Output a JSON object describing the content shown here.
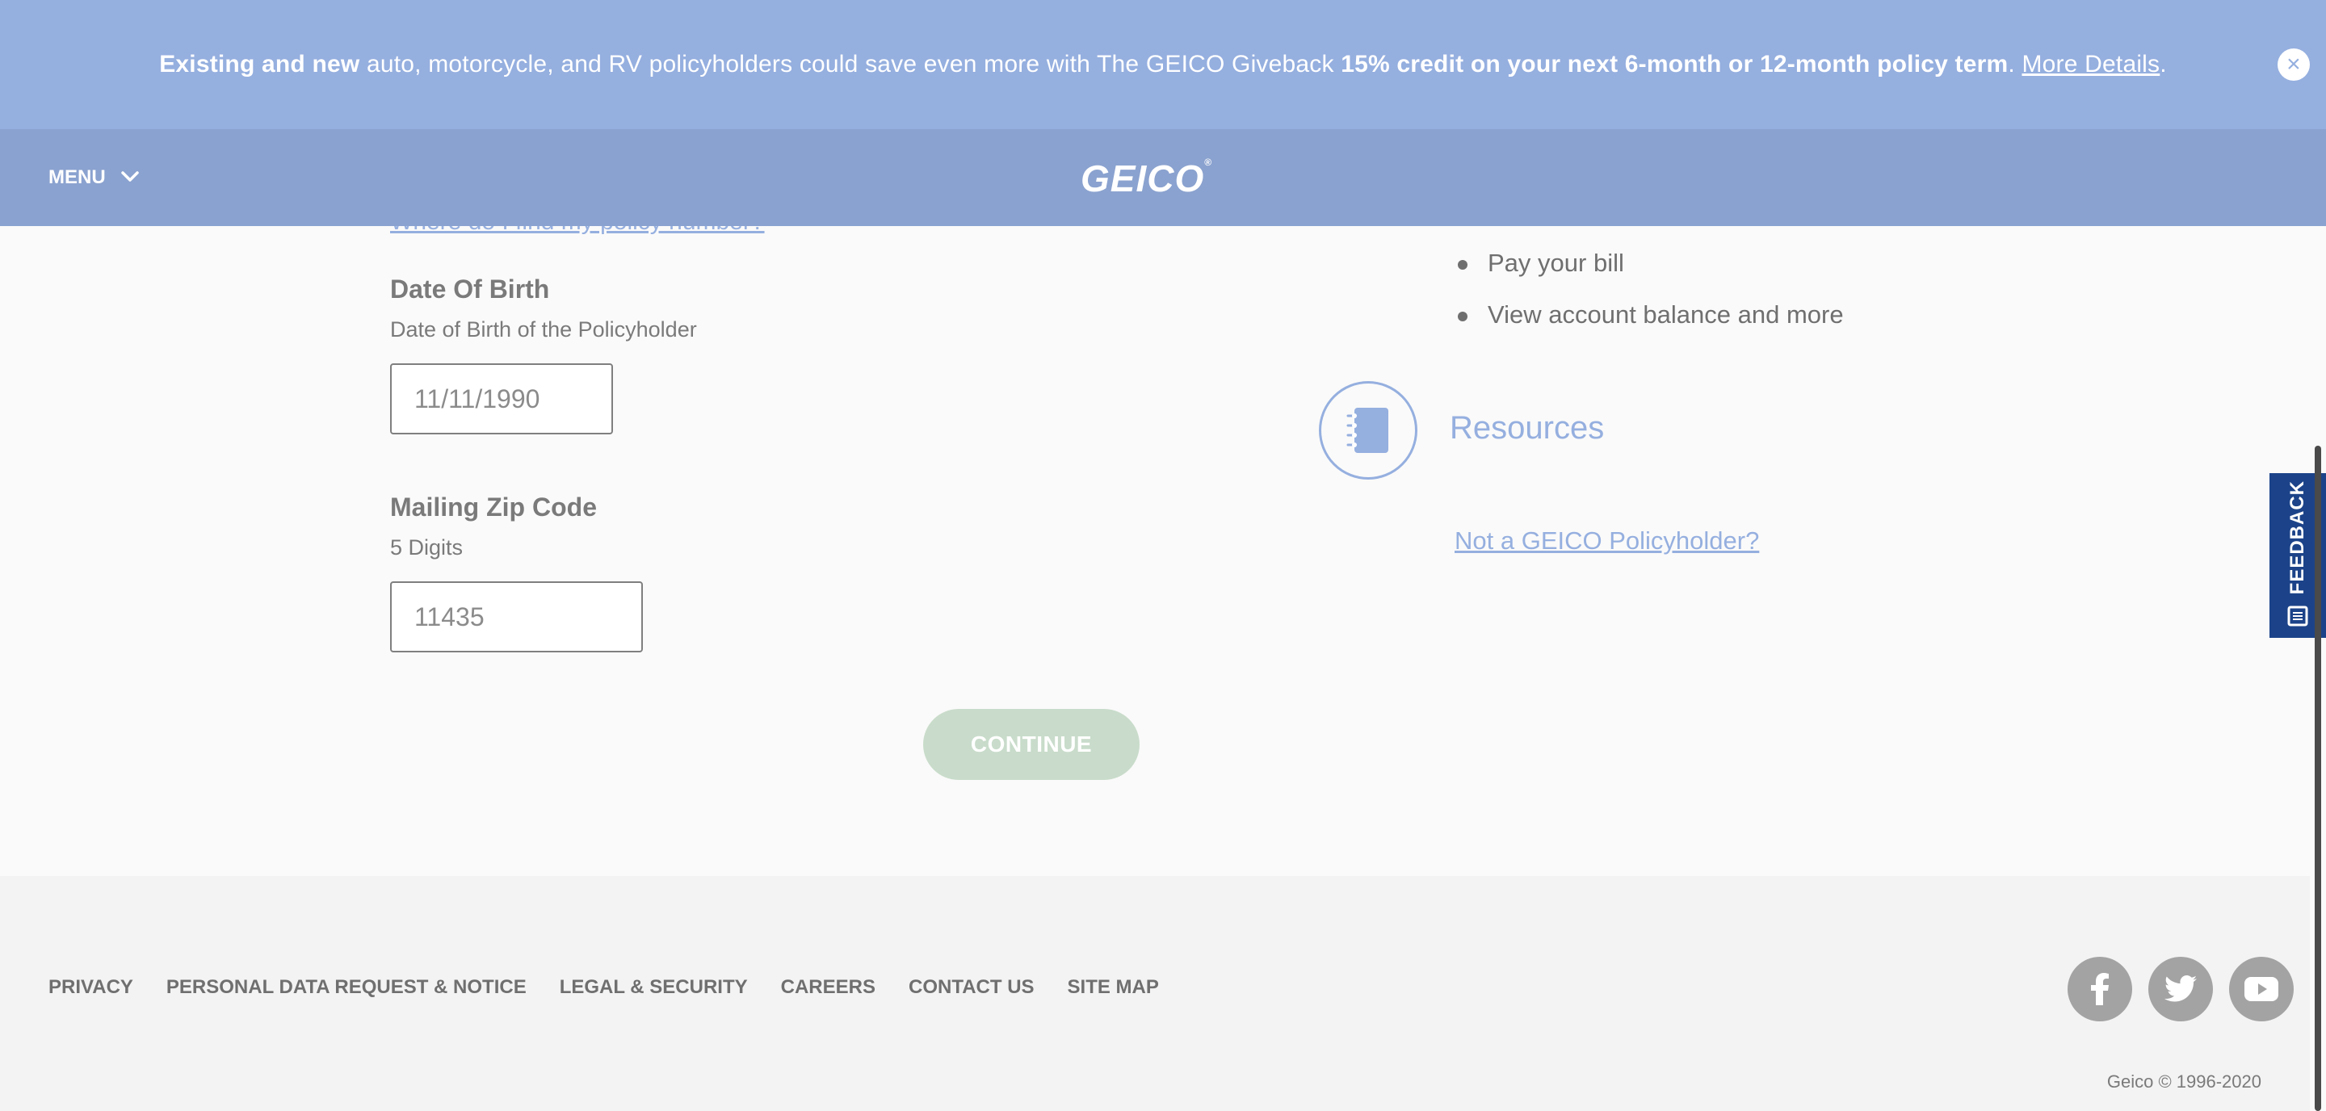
{
  "promo": {
    "bold_start": "Existing and new",
    "middle": " auto, motorcycle, and RV policyholders could save even more with The GEICO Giveback ",
    "bold_credit": "15% credit on your next 6-month or 12-month policy term",
    "period": ".",
    "link": "More Details",
    "end": ".",
    "close_glyph": "×"
  },
  "header": {
    "menu_label": "MENU",
    "logo_text": "GEICO",
    "logo_mark": "®"
  },
  "form": {
    "partial_link": "Where do I find my policy number?",
    "dob": {
      "label": "Date Of Birth",
      "help": "Date of Birth of the Policyholder",
      "value": "11/11/1990"
    },
    "zip": {
      "label": "Mailing Zip Code",
      "help": "5 Digits",
      "value": "11435"
    },
    "continue_label": "CONTINUE"
  },
  "sidebar": {
    "bullets": [
      "Pay your bill",
      "View account balance and more"
    ],
    "resources_label": "Resources",
    "not_policyholder_link": "Not a GEICO Policyholder?"
  },
  "feedback": {
    "label": "FEEDBACK"
  },
  "footer": {
    "links": [
      "PRIVACY",
      "PERSONAL DATA REQUEST & NOTICE",
      "LEGAL & SECURITY",
      "CAREERS",
      "CONTACT US",
      "SITE MAP"
    ],
    "socials": [
      "facebook-icon",
      "twitter-icon",
      "youtube-icon"
    ],
    "copyright": "Geico © 1996-2020"
  },
  "colors": {
    "promo_bg": "#95afdf",
    "header_bg": "#8aa2cf",
    "feedback_bg": "#1c4389",
    "continue_bg": "#c9dccb",
    "link": "#95afdf"
  }
}
